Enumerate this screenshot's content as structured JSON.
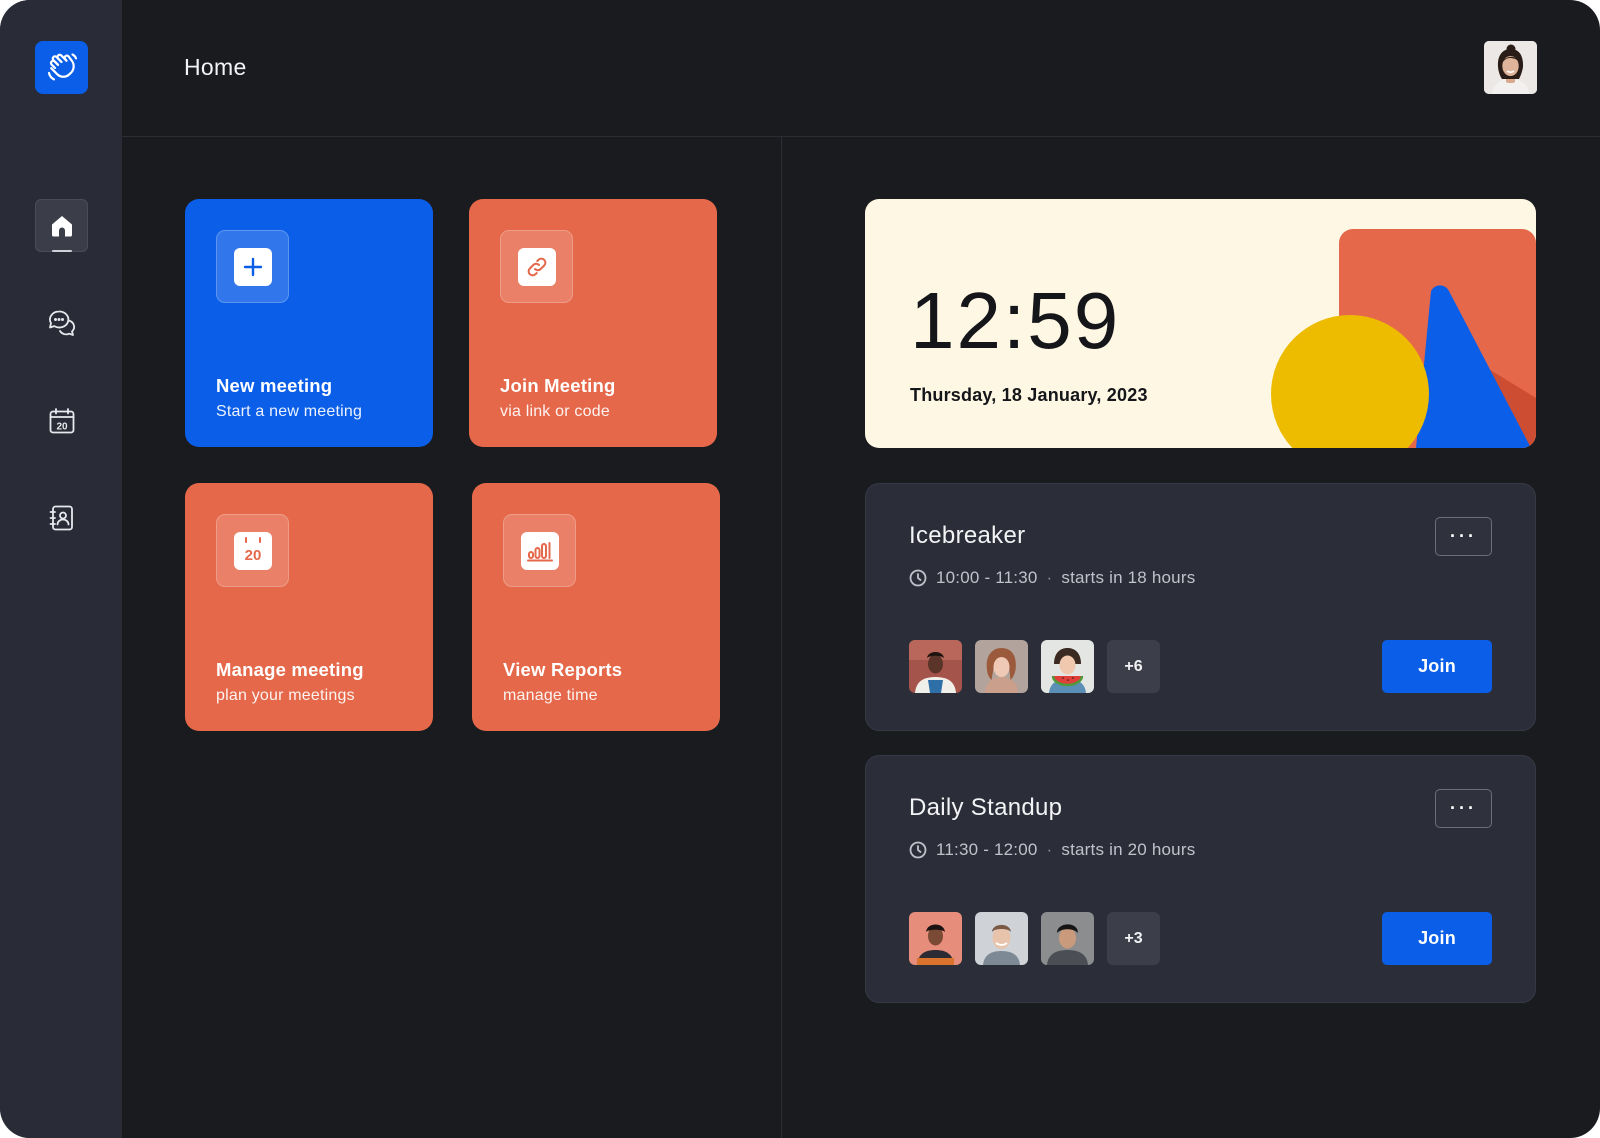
{
  "app": {
    "title": "Home",
    "logo_icon": "waving-hand-icon",
    "brand_color": "#0a5ee8",
    "accent_color": "#e5684a"
  },
  "sidebar": {
    "items": [
      {
        "id": "home",
        "icon": "home-icon",
        "active": true
      },
      {
        "id": "chat",
        "icon": "chat-bubbles-icon",
        "active": false
      },
      {
        "id": "calendar",
        "icon": "calendar-icon",
        "calendar_day": "20",
        "active": false
      },
      {
        "id": "contacts",
        "icon": "contacts-book-icon",
        "active": false
      }
    ]
  },
  "tiles": [
    {
      "id": "new-meeting",
      "title": "New meeting",
      "subtitle": "Start a new meeting",
      "icon": "plus-icon",
      "color": "#0a5ee8"
    },
    {
      "id": "join-meeting",
      "title": "Join Meeting",
      "subtitle": "via link or code",
      "icon": "link-icon",
      "color": "#e5684a"
    },
    {
      "id": "manage-meeting",
      "title": "Manage meeting",
      "subtitle": "plan your meetings",
      "icon": "calendar-icon",
      "icon_text": "20",
      "color": "#e5684a"
    },
    {
      "id": "view-reports",
      "title": "View Reports",
      "subtitle": "manage time",
      "icon": "bar-chart-icon",
      "color": "#e5684a"
    }
  ],
  "clock": {
    "time": "12:59",
    "date": "Thursday, 18 January, 2023"
  },
  "meetings": [
    {
      "title": "Icebreaker",
      "time_range": "10:00 - 11:30",
      "separator": "·",
      "starts_in": "starts in 18 hours",
      "more_label": "···",
      "extra_participants": "+6",
      "join_label": "Join"
    },
    {
      "title": "Daily Standup",
      "time_range": "11:30 - 12:00",
      "separator": "·",
      "starts_in": "starts in 20 hours",
      "more_label": "···",
      "extra_participants": "+3",
      "join_label": "Join"
    }
  ]
}
